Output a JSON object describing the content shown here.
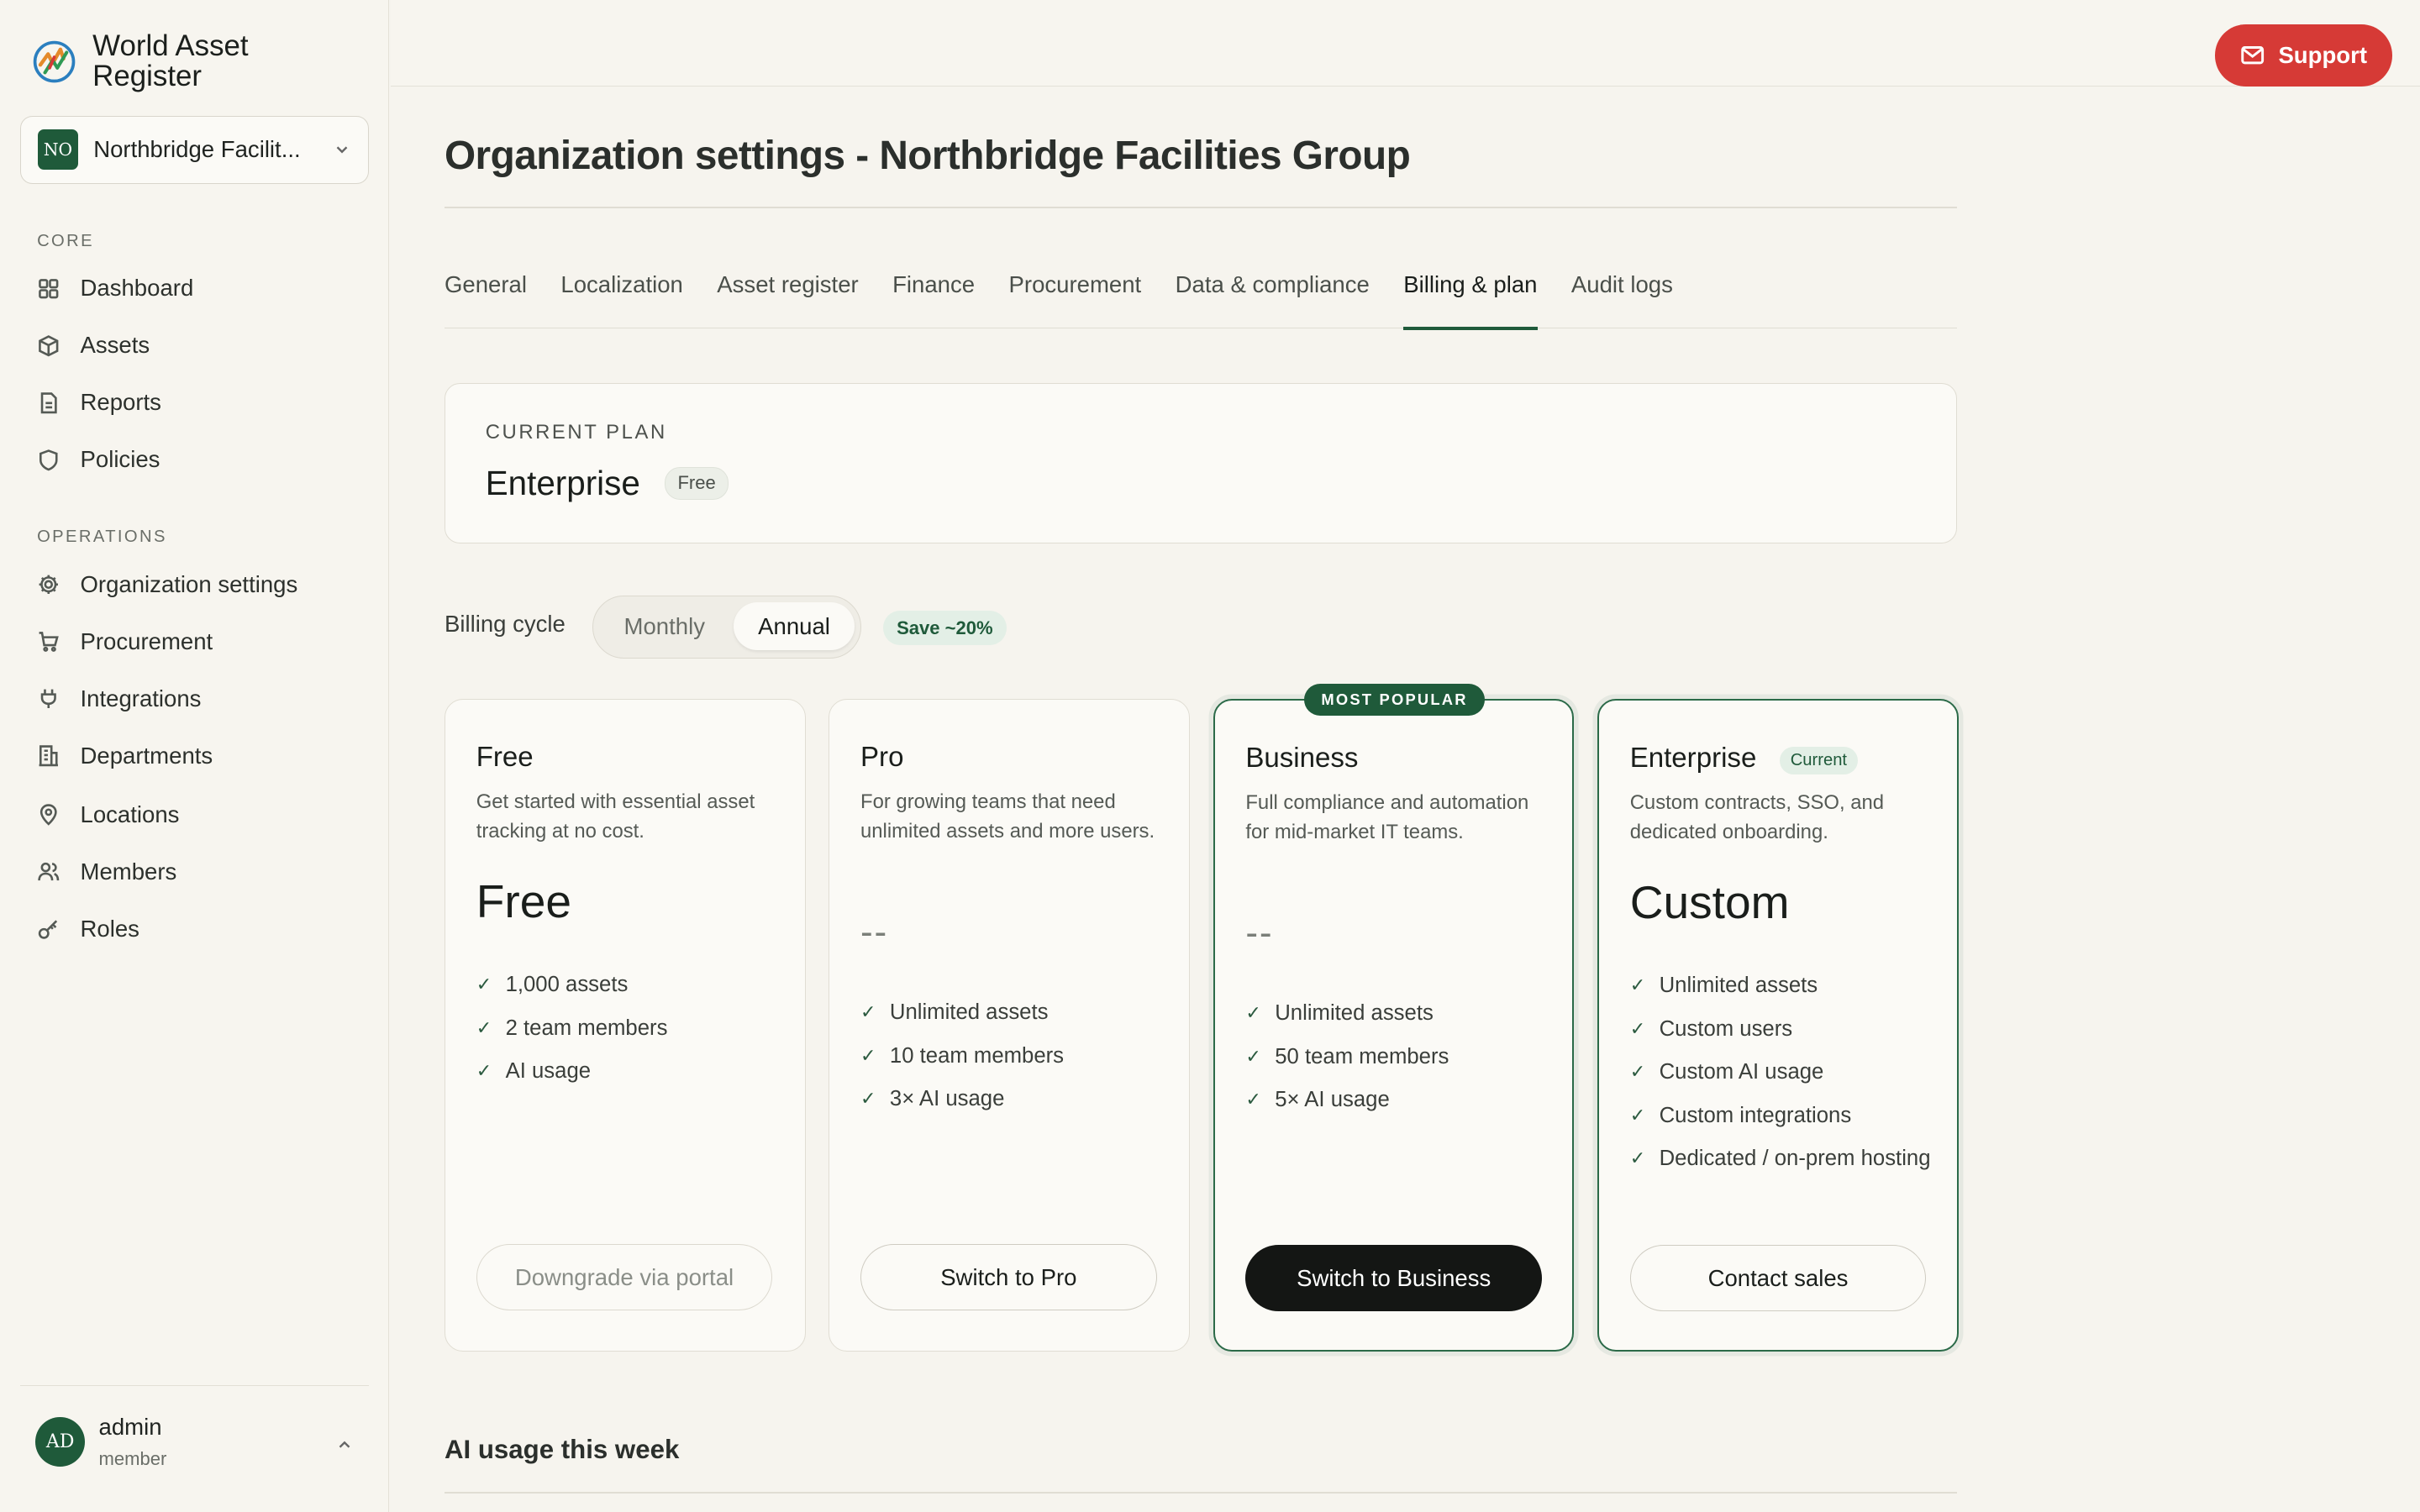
{
  "app": {
    "name": "World Asset Register"
  },
  "org": {
    "badge": "NO",
    "name": "Northbridge Facilit..."
  },
  "sidebar": {
    "core_label": "CORE",
    "core_items": [
      {
        "label": "Dashboard",
        "icon": "grid-icon"
      },
      {
        "label": "Assets",
        "icon": "cube-icon"
      },
      {
        "label": "Reports",
        "icon": "document-icon"
      },
      {
        "label": "Policies",
        "icon": "shield-icon"
      }
    ],
    "ops_label": "OPERATIONS",
    "ops_items": [
      {
        "label": "Organization settings",
        "icon": "gear-icon"
      },
      {
        "label": "Procurement",
        "icon": "cart-icon"
      },
      {
        "label": "Integrations",
        "icon": "plug-icon"
      },
      {
        "label": "Departments",
        "icon": "building-icon"
      },
      {
        "label": "Locations",
        "icon": "map-pin-icon"
      },
      {
        "label": "Members",
        "icon": "users-icon"
      },
      {
        "label": "Roles",
        "icon": "key-icon"
      }
    ]
  },
  "user": {
    "initials": "AD",
    "name": "admin",
    "role": "member"
  },
  "topbar": {
    "support_label": "Support"
  },
  "page": {
    "title": "Organization settings - Northbridge Facilities Group"
  },
  "tabs": [
    "General",
    "Localization",
    "Asset register",
    "Finance",
    "Procurement",
    "Data & compliance",
    "Billing & plan",
    "Audit logs"
  ],
  "active_tab": "Billing & plan",
  "current_plan": {
    "label": "CURRENT PLAN",
    "name": "Enterprise",
    "badge": "Free"
  },
  "billing": {
    "label": "Billing cycle",
    "monthly": "Monthly",
    "annual": "Annual",
    "selected": "Annual",
    "save_badge": "Save ~20%"
  },
  "plans": [
    {
      "name": "Free",
      "desc": "Get started with essential asset tracking at no cost.",
      "price": "Free",
      "features": [
        "1,000 assets",
        "2 team members",
        "AI usage"
      ],
      "button": "Downgrade via portal"
    },
    {
      "name": "Pro",
      "desc": "For growing teams that need unlimited assets and more users.",
      "price": "--",
      "features": [
        "Unlimited assets",
        "10 team members",
        "3× AI usage"
      ],
      "button": "Switch to Pro"
    },
    {
      "name": "Business",
      "tag": "MOST POPULAR",
      "desc": "Full compliance and automation for mid-market IT teams.",
      "price": "--",
      "features": [
        "Unlimited assets",
        "50 team members",
        "5× AI usage"
      ],
      "button": "Switch to Business"
    },
    {
      "name": "Enterprise",
      "tag": "Current",
      "desc": "Custom contracts, SSO, and dedicated onboarding.",
      "price": "Custom",
      "features": [
        "Unlimited assets",
        "Custom users",
        "Custom AI usage",
        "Custom integrations",
        "Dedicated / on-prem hosting"
      ],
      "button": "Contact sales"
    }
  ],
  "ai_section": {
    "title": "AI usage this week"
  },
  "colors": {
    "accent": "#1f5a3a",
    "support": "#d63a36",
    "background": "#f6f4ee"
  }
}
